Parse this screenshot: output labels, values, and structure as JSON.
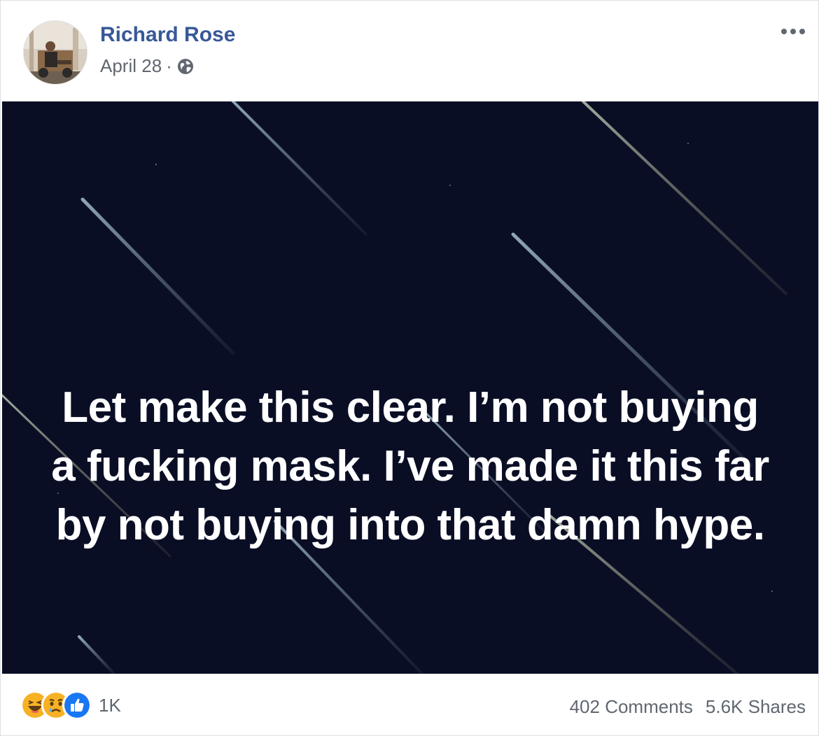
{
  "post": {
    "author": "Richard Rose",
    "date": "April 28",
    "date_separator": "·",
    "privacy_icon": "globe-icon",
    "more_icon": "ellipsis-icon",
    "body_text": "Let make this clear. I’m not buying a fucking mask. I’ve made it this far by not buying into that damn hype.",
    "background_color": "#0a0e25",
    "text_color": "#ffffff"
  },
  "footer": {
    "reaction_icons": [
      "haha-icon",
      "sad-icon",
      "like-icon"
    ],
    "reaction_count": "1K",
    "comments": "402 Comments",
    "shares": "5.6K Shares"
  },
  "colors": {
    "author_link": "#385898",
    "meta_text": "#616770",
    "like_blue": "#1877f2",
    "reaction_yellow": "#f7b125"
  }
}
